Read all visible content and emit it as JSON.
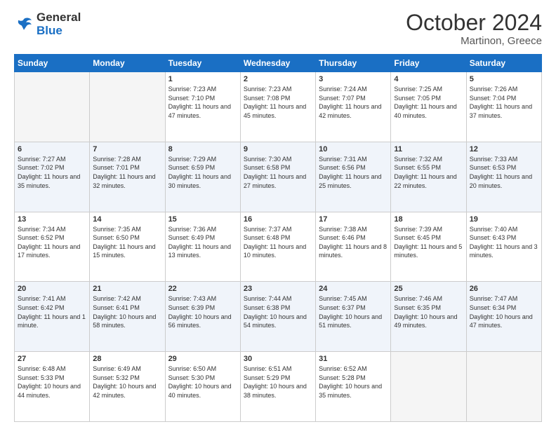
{
  "header": {
    "logo_general": "General",
    "logo_blue": "Blue",
    "month_title": "October 2024",
    "subtitle": "Martinon, Greece"
  },
  "days_of_week": [
    "Sunday",
    "Monday",
    "Tuesday",
    "Wednesday",
    "Thursday",
    "Friday",
    "Saturday"
  ],
  "weeks": [
    [
      {
        "day": "",
        "empty": true
      },
      {
        "day": "",
        "empty": true
      },
      {
        "day": "1",
        "sunrise": "7:23 AM",
        "sunset": "7:10 PM",
        "daylight": "11 hours and 47 minutes."
      },
      {
        "day": "2",
        "sunrise": "7:23 AM",
        "sunset": "7:08 PM",
        "daylight": "11 hours and 45 minutes."
      },
      {
        "day": "3",
        "sunrise": "7:24 AM",
        "sunset": "7:07 PM",
        "daylight": "11 hours and 42 minutes."
      },
      {
        "day": "4",
        "sunrise": "7:25 AM",
        "sunset": "7:05 PM",
        "daylight": "11 hours and 40 minutes."
      },
      {
        "day": "5",
        "sunrise": "7:26 AM",
        "sunset": "7:04 PM",
        "daylight": "11 hours and 37 minutes."
      }
    ],
    [
      {
        "day": "6",
        "sunrise": "7:27 AM",
        "sunset": "7:02 PM",
        "daylight": "11 hours and 35 minutes."
      },
      {
        "day": "7",
        "sunrise": "7:28 AM",
        "sunset": "7:01 PM",
        "daylight": "11 hours and 32 minutes."
      },
      {
        "day": "8",
        "sunrise": "7:29 AM",
        "sunset": "6:59 PM",
        "daylight": "11 hours and 30 minutes."
      },
      {
        "day": "9",
        "sunrise": "7:30 AM",
        "sunset": "6:58 PM",
        "daylight": "11 hours and 27 minutes."
      },
      {
        "day": "10",
        "sunrise": "7:31 AM",
        "sunset": "6:56 PM",
        "daylight": "11 hours and 25 minutes."
      },
      {
        "day": "11",
        "sunrise": "7:32 AM",
        "sunset": "6:55 PM",
        "daylight": "11 hours and 22 minutes."
      },
      {
        "day": "12",
        "sunrise": "7:33 AM",
        "sunset": "6:53 PM",
        "daylight": "11 hours and 20 minutes."
      }
    ],
    [
      {
        "day": "13",
        "sunrise": "7:34 AM",
        "sunset": "6:52 PM",
        "daylight": "11 hours and 17 minutes."
      },
      {
        "day": "14",
        "sunrise": "7:35 AM",
        "sunset": "6:50 PM",
        "daylight": "11 hours and 15 minutes."
      },
      {
        "day": "15",
        "sunrise": "7:36 AM",
        "sunset": "6:49 PM",
        "daylight": "11 hours and 13 minutes."
      },
      {
        "day": "16",
        "sunrise": "7:37 AM",
        "sunset": "6:48 PM",
        "daylight": "11 hours and 10 minutes."
      },
      {
        "day": "17",
        "sunrise": "7:38 AM",
        "sunset": "6:46 PM",
        "daylight": "11 hours and 8 minutes."
      },
      {
        "day": "18",
        "sunrise": "7:39 AM",
        "sunset": "6:45 PM",
        "daylight": "11 hours and 5 minutes."
      },
      {
        "day": "19",
        "sunrise": "7:40 AM",
        "sunset": "6:43 PM",
        "daylight": "11 hours and 3 minutes."
      }
    ],
    [
      {
        "day": "20",
        "sunrise": "7:41 AM",
        "sunset": "6:42 PM",
        "daylight": "11 hours and 1 minute."
      },
      {
        "day": "21",
        "sunrise": "7:42 AM",
        "sunset": "6:41 PM",
        "daylight": "10 hours and 58 minutes."
      },
      {
        "day": "22",
        "sunrise": "7:43 AM",
        "sunset": "6:39 PM",
        "daylight": "10 hours and 56 minutes."
      },
      {
        "day": "23",
        "sunrise": "7:44 AM",
        "sunset": "6:38 PM",
        "daylight": "10 hours and 54 minutes."
      },
      {
        "day": "24",
        "sunrise": "7:45 AM",
        "sunset": "6:37 PM",
        "daylight": "10 hours and 51 minutes."
      },
      {
        "day": "25",
        "sunrise": "7:46 AM",
        "sunset": "6:35 PM",
        "daylight": "10 hours and 49 minutes."
      },
      {
        "day": "26",
        "sunrise": "7:47 AM",
        "sunset": "6:34 PM",
        "daylight": "10 hours and 47 minutes."
      }
    ],
    [
      {
        "day": "27",
        "sunrise": "6:48 AM",
        "sunset": "5:33 PM",
        "daylight": "10 hours and 44 minutes."
      },
      {
        "day": "28",
        "sunrise": "6:49 AM",
        "sunset": "5:32 PM",
        "daylight": "10 hours and 42 minutes."
      },
      {
        "day": "29",
        "sunrise": "6:50 AM",
        "sunset": "5:30 PM",
        "daylight": "10 hours and 40 minutes."
      },
      {
        "day": "30",
        "sunrise": "6:51 AM",
        "sunset": "5:29 PM",
        "daylight": "10 hours and 38 minutes."
      },
      {
        "day": "31",
        "sunrise": "6:52 AM",
        "sunset": "5:28 PM",
        "daylight": "10 hours and 35 minutes."
      },
      {
        "day": "",
        "empty": true
      },
      {
        "day": "",
        "empty": true
      }
    ]
  ],
  "labels": {
    "sunrise": "Sunrise:",
    "sunset": "Sunset:",
    "daylight": "Daylight:"
  }
}
